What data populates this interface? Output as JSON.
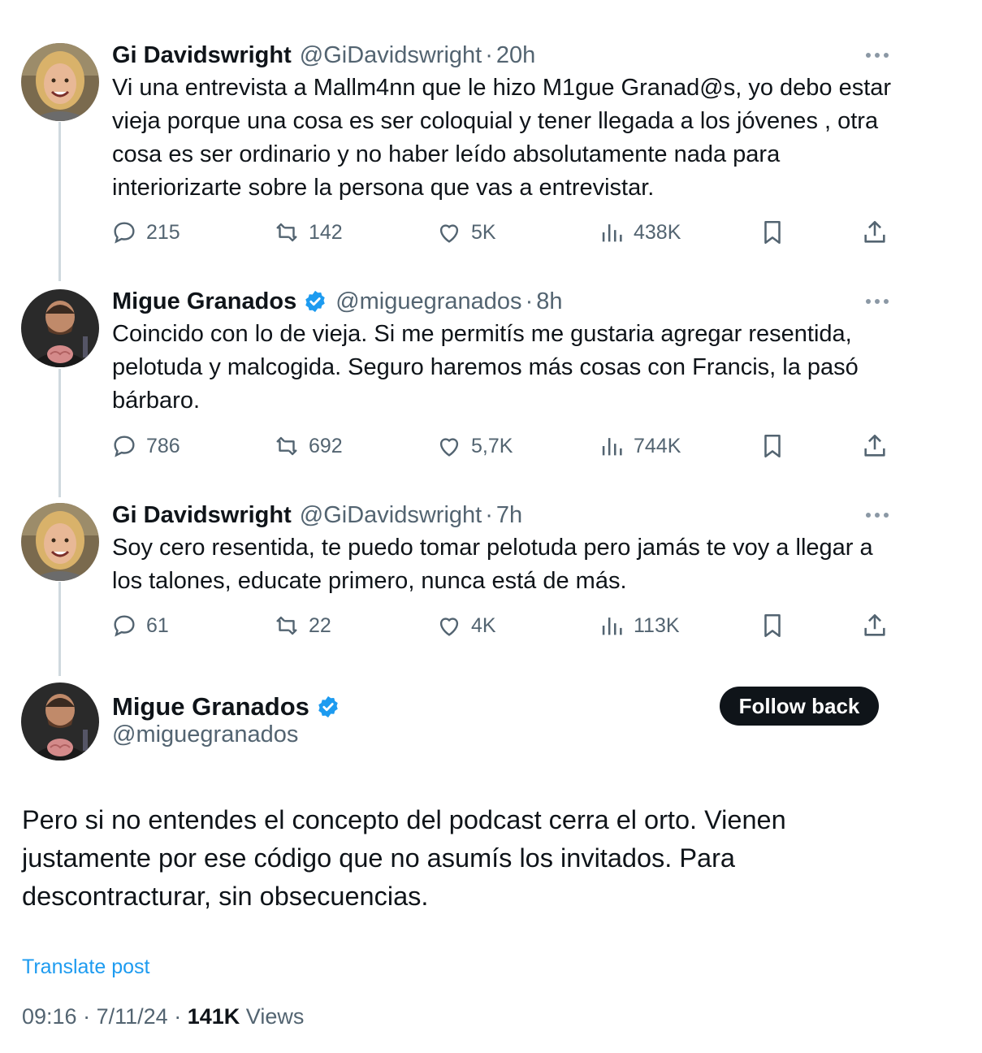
{
  "colors": {
    "text": "#0f1419",
    "secondary": "#536471",
    "link": "#1d9bf0",
    "verified": "#1d9bf0",
    "thread_line": "#cfd9de",
    "button_bg": "#0f1419"
  },
  "thread": [
    {
      "name": "Gi Davidswright",
      "handle": "@GiDavidswright",
      "sep": "·",
      "time": "20h",
      "verified": false,
      "text": "Vi una entrevista a Mallm4nn que le hizo M1gue Granad@s, yo debo estar vieja porque una cosa es ser coloquial y tener llegada a los jóvenes , otra cosa es ser ordinario y no haber leído absolutamente nada para interiorizarte sobre la persona que vas a entrevistar.",
      "replies": "215",
      "reposts": "142",
      "likes": "5K",
      "views": "438K"
    },
    {
      "name": "Migue Granados",
      "handle": "@miguegranados",
      "sep": "·",
      "time": "8h",
      "verified": true,
      "text": "Coincido con lo de vieja. Si me permitís me gustaria agregar resentida, pelotuda y malcogida. Seguro haremos más cosas con Francis, la pasó bárbaro.",
      "replies": "786",
      "reposts": "692",
      "likes": "5,7K",
      "views": "744K"
    },
    {
      "name": "Gi Davidswright",
      "handle": "@GiDavidswright",
      "sep": "·",
      "time": "7h",
      "verified": false,
      "text": "Soy cero resentida, te puedo tomar pelotuda pero jamás te voy a llegar a los talones, educate primero, nunca está de más.",
      "replies": "61",
      "reposts": "22",
      "likes": "4K",
      "views": "113K"
    }
  ],
  "main": {
    "name": "Migue Granados",
    "handle": "@miguegranados",
    "follow_label": "Follow back",
    "text": "Pero si no entendes el concepto del podcast cerra el orto. Vienen justamente por ese código que no asumís los invitados. Para descontracturar, sin obsecuencias.",
    "translate_label": "Translate post",
    "time": "09:16",
    "date": "7/11/24",
    "sep": "·",
    "views_count": "141K",
    "views_label": "Views"
  }
}
